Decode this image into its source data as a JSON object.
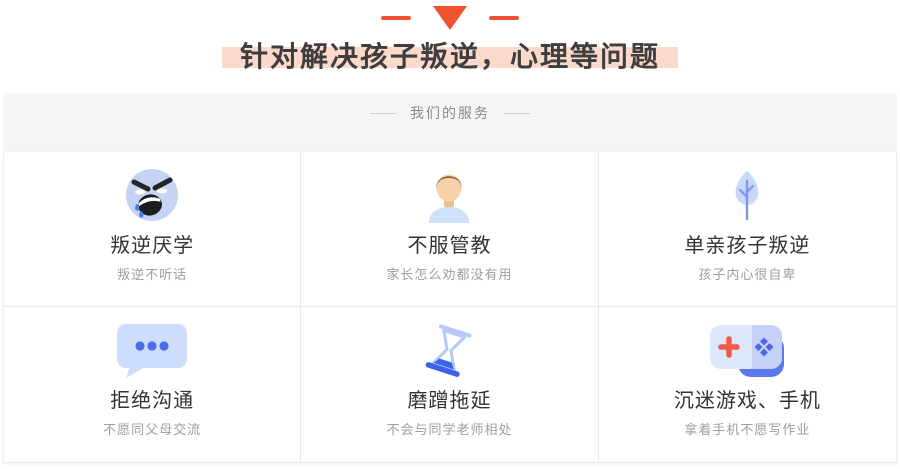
{
  "header": {
    "title": "针对解决孩子叛逆，心理等问题",
    "decoration": {
      "shape": "dash-triangle-dash",
      "color": "#f0512f"
    },
    "title_color": "#3e3e3e",
    "highlight_color": "#fbdacb"
  },
  "section": {
    "label": "我们的服务",
    "background": "#f6f6f7",
    "label_color": "#8a8a8a"
  },
  "services": {
    "items": [
      {
        "icon": "angry-face-icon",
        "title": "叛逆厌学",
        "subtitle": "叛逆不听话"
      },
      {
        "icon": "boy-avatar-icon",
        "title": "不服管教",
        "subtitle": "家长怎么劝都没有用"
      },
      {
        "icon": "leaf-icon",
        "title": "单亲孩子叛逆",
        "subtitle": "孩子内心很自卑"
      },
      {
        "icon": "chat-bubble-icon",
        "title": "拒绝沟通",
        "subtitle": "不愿同父母交流"
      },
      {
        "icon": "hourglass-icon",
        "title": "磨蹭拖延",
        "subtitle": "不会与同学老师相处"
      },
      {
        "icon": "gamepad-icon",
        "title": "沉迷游戏、手机",
        "subtitle": "拿着手机不愿写作业"
      }
    ]
  },
  "colors": {
    "accent": "#f0512f",
    "icon_light_blue": "#cdddfc",
    "icon_blue": "#4b6ce6",
    "border": "#ebebeb",
    "subtitle_gray": "#9e9e9e"
  }
}
